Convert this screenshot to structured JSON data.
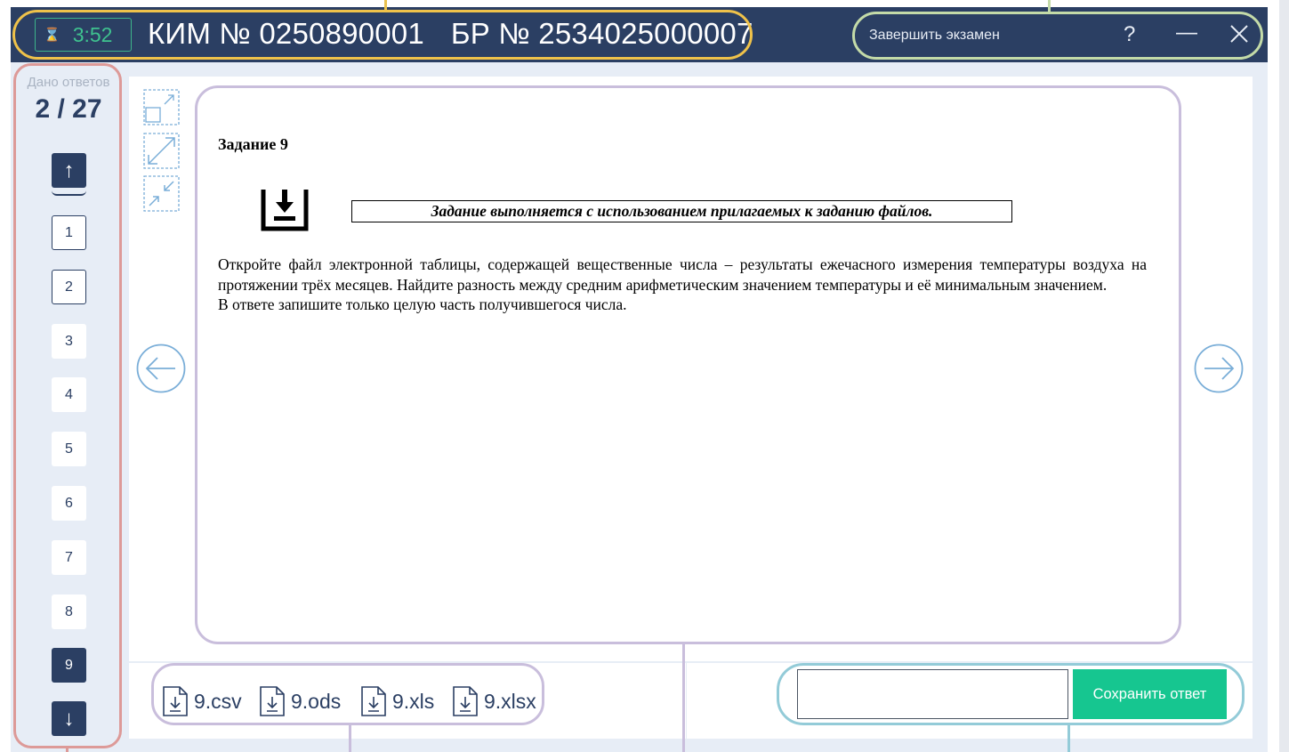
{
  "header": {
    "timer": "3:52",
    "kim": "КИМ № 0250890001",
    "br": "БР № 2534025000007",
    "finish_label": "Завершить экзамен",
    "help_glyph": "?",
    "minimize_glyph": "—",
    "close_glyph": "✕"
  },
  "sidebar": {
    "answered_label": "Дано ответов",
    "answered_count": "2 / 27",
    "up_glyph": "↑",
    "down_glyph": "↓",
    "questions": [
      {
        "num": "1",
        "state": "answered"
      },
      {
        "num": "2",
        "state": "answered"
      },
      {
        "num": "3",
        "state": "unanswered"
      },
      {
        "num": "4",
        "state": "unanswered"
      },
      {
        "num": "5",
        "state": "unanswered"
      },
      {
        "num": "6",
        "state": "unanswered"
      },
      {
        "num": "7",
        "state": "unanswered"
      },
      {
        "num": "8",
        "state": "unanswered"
      },
      {
        "num": "9",
        "state": "current"
      }
    ]
  },
  "task": {
    "title": "Задание 9",
    "note": "Задание выполняется с использованием прилагаемых к заданию файлов.",
    "paragraph1": "Откройте файл электронной таблицы, содержащей вещественные числа – результаты ежечасного измерения температуры воздуха на протяжении трёх месяцев. Найдите разность между средним арифметическим значением температуры и её минимальным значением.",
    "paragraph2": "В ответе запишите только целую часть получившегося числа."
  },
  "files": [
    {
      "name": "9.csv"
    },
    {
      "name": "9.ods"
    },
    {
      "name": "9.xls"
    },
    {
      "name": "9.xlsx"
    }
  ],
  "answer": {
    "value": "",
    "placeholder": "",
    "save_label": "Сохранить ответ"
  },
  "colors": {
    "header_bg": "#2b3f63",
    "accent_green": "#16c690",
    "timer_green": "#3fc28f",
    "highlight_orange": "#efc24a",
    "highlight_red": "#dd9a98",
    "highlight_lavender": "#c9bedc",
    "highlight_teal": "#93cbd8",
    "highlight_sage": "#c4dba8"
  }
}
